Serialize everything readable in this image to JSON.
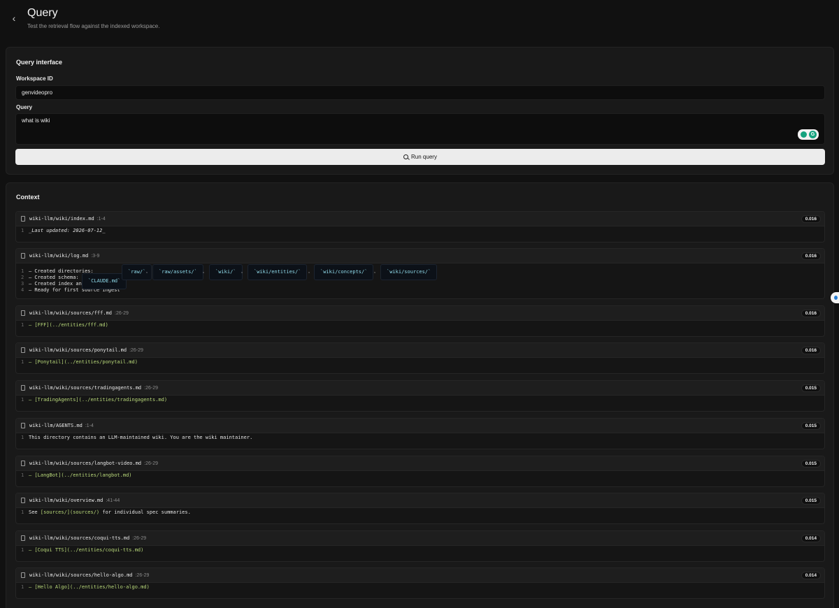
{
  "header": {
    "title": "Query",
    "subtitle": "Test the retrieval flow against the indexed workspace.",
    "back_icon": "‹"
  },
  "query_card": {
    "title": "Query interface",
    "workspace_label": "Workspace ID",
    "workspace_value": "genvideopro",
    "query_label": "Query",
    "query_value": "what is wiki",
    "run_label": "Run query"
  },
  "context": {
    "title": "Context",
    "results": [
      {
        "path": "wiki-llm/wiki/index.md",
        "range": ":1-4",
        "score": "0.016",
        "lines": [
          {
            "n": "1",
            "text": "_Last updated: 2026-07-12_",
            "style": "em"
          }
        ]
      },
      {
        "path": "wiki-llm/wiki/log.md",
        "range": ":3-9",
        "score": "0.016",
        "lines": [
          {
            "n": "1",
            "text": "– Created directories:"
          },
          {
            "n": "2",
            "text": "– Created schema:"
          },
          {
            "n": "3",
            "text": "– Created index and log"
          },
          {
            "n": "4",
            "text": "– Ready for first source ingest"
          }
        ],
        "chips": [
          "`raw/`",
          "`raw/assets/`",
          "`wiki/`",
          "`wiki/entities/`",
          "`wiki/concepts/`",
          "`wiki/sources/`"
        ],
        "schema_chip": "`CLAUDE.md`",
        "sep": ","
      },
      {
        "path": "wiki-llm/wiki/sources/fff.md",
        "range": ":26-29",
        "score": "0.016",
        "lines": [
          {
            "n": "1",
            "text": "– [FFF](../entities/fff.md)",
            "style": "link"
          }
        ]
      },
      {
        "path": "wiki-llm/wiki/sources/ponytail.md",
        "range": ":26-29",
        "score": "0.016",
        "lines": [
          {
            "n": "1",
            "text": "– [Ponytail](../entities/ponytail.md)",
            "style": "link"
          }
        ]
      },
      {
        "path": "wiki-llm/wiki/sources/tradingagents.md",
        "range": ":26-29",
        "score": "0.015",
        "lines": [
          {
            "n": "1",
            "text": "– [TradingAgents](../entities/tradingagents.md)",
            "style": "link"
          }
        ]
      },
      {
        "path": "wiki-llm/AGENTS.md",
        "range": ":1-4",
        "score": "0.015",
        "lines": [
          {
            "n": "1",
            "text": "This directory contains an LLM-maintained wiki. You are the wiki maintainer."
          }
        ]
      },
      {
        "path": "wiki-llm/wiki/sources/langbot-video.md",
        "range": ":26-29",
        "score": "0.015",
        "lines": [
          {
            "n": "1",
            "text": "– [LangBot](../entities/langbot.md)",
            "style": "link"
          }
        ]
      },
      {
        "path": "wiki-llm/wiki/overview.md",
        "range": ":41-44",
        "score": "0.015",
        "lines": [
          {
            "n": "1",
            "pre": "See ",
            "link": "[sources/](sources/)",
            "post": " for individual spec summaries."
          }
        ]
      },
      {
        "path": "wiki-llm/wiki/sources/coqui-tts.md",
        "range": ":26-29",
        "score": "0.014",
        "lines": [
          {
            "n": "1",
            "text": "– [Coqui TTS](../entities/coqui-tts.md)",
            "style": "link"
          }
        ]
      },
      {
        "path": "wiki-llm/wiki/sources/hello-algo.md",
        "range": ":26-29",
        "score": "0.014",
        "lines": [
          {
            "n": "1",
            "text": "– [Hello Algo](../entities/hello-algo.md)",
            "style": "link"
          }
        ]
      }
    ]
  }
}
